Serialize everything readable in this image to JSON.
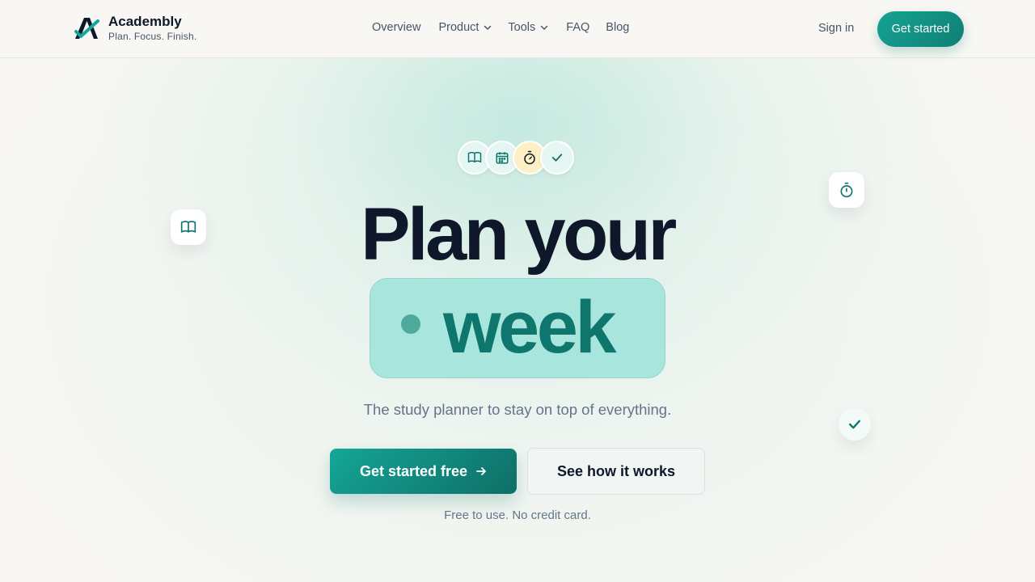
{
  "header": {
    "brand": {
      "name": "Academbly",
      "tagline": "Plan. Focus. Finish."
    },
    "nav": [
      {
        "label": "Overview",
        "has_dropdown": false
      },
      {
        "label": "Product",
        "has_dropdown": true
      },
      {
        "label": "Tools",
        "has_dropdown": true
      },
      {
        "label": "FAQ",
        "has_dropdown": false
      },
      {
        "label": "Blog",
        "has_dropdown": false
      }
    ],
    "sign_in_label": "Sign in",
    "get_started_label": "Get started"
  },
  "hero": {
    "icon_cluster": [
      "book-icon",
      "calendar-icon",
      "stopwatch-icon",
      "check-icon"
    ],
    "title_line1": "Plan your",
    "title_word": "week",
    "subtitle": "The study planner to stay on top of everything.",
    "primary_cta": "Get started free",
    "secondary_cta": "See how it works",
    "fine_print": "Free to use. No credit card."
  },
  "floating_icons": [
    "book-icon",
    "stopwatch-icon",
    "check-icon"
  ],
  "colors": {
    "accent": "#0f766e",
    "accent_light": "#a8e6dd",
    "text_dark": "#0f172a",
    "text_muted": "#64748b",
    "background": "#f8f7f3"
  }
}
